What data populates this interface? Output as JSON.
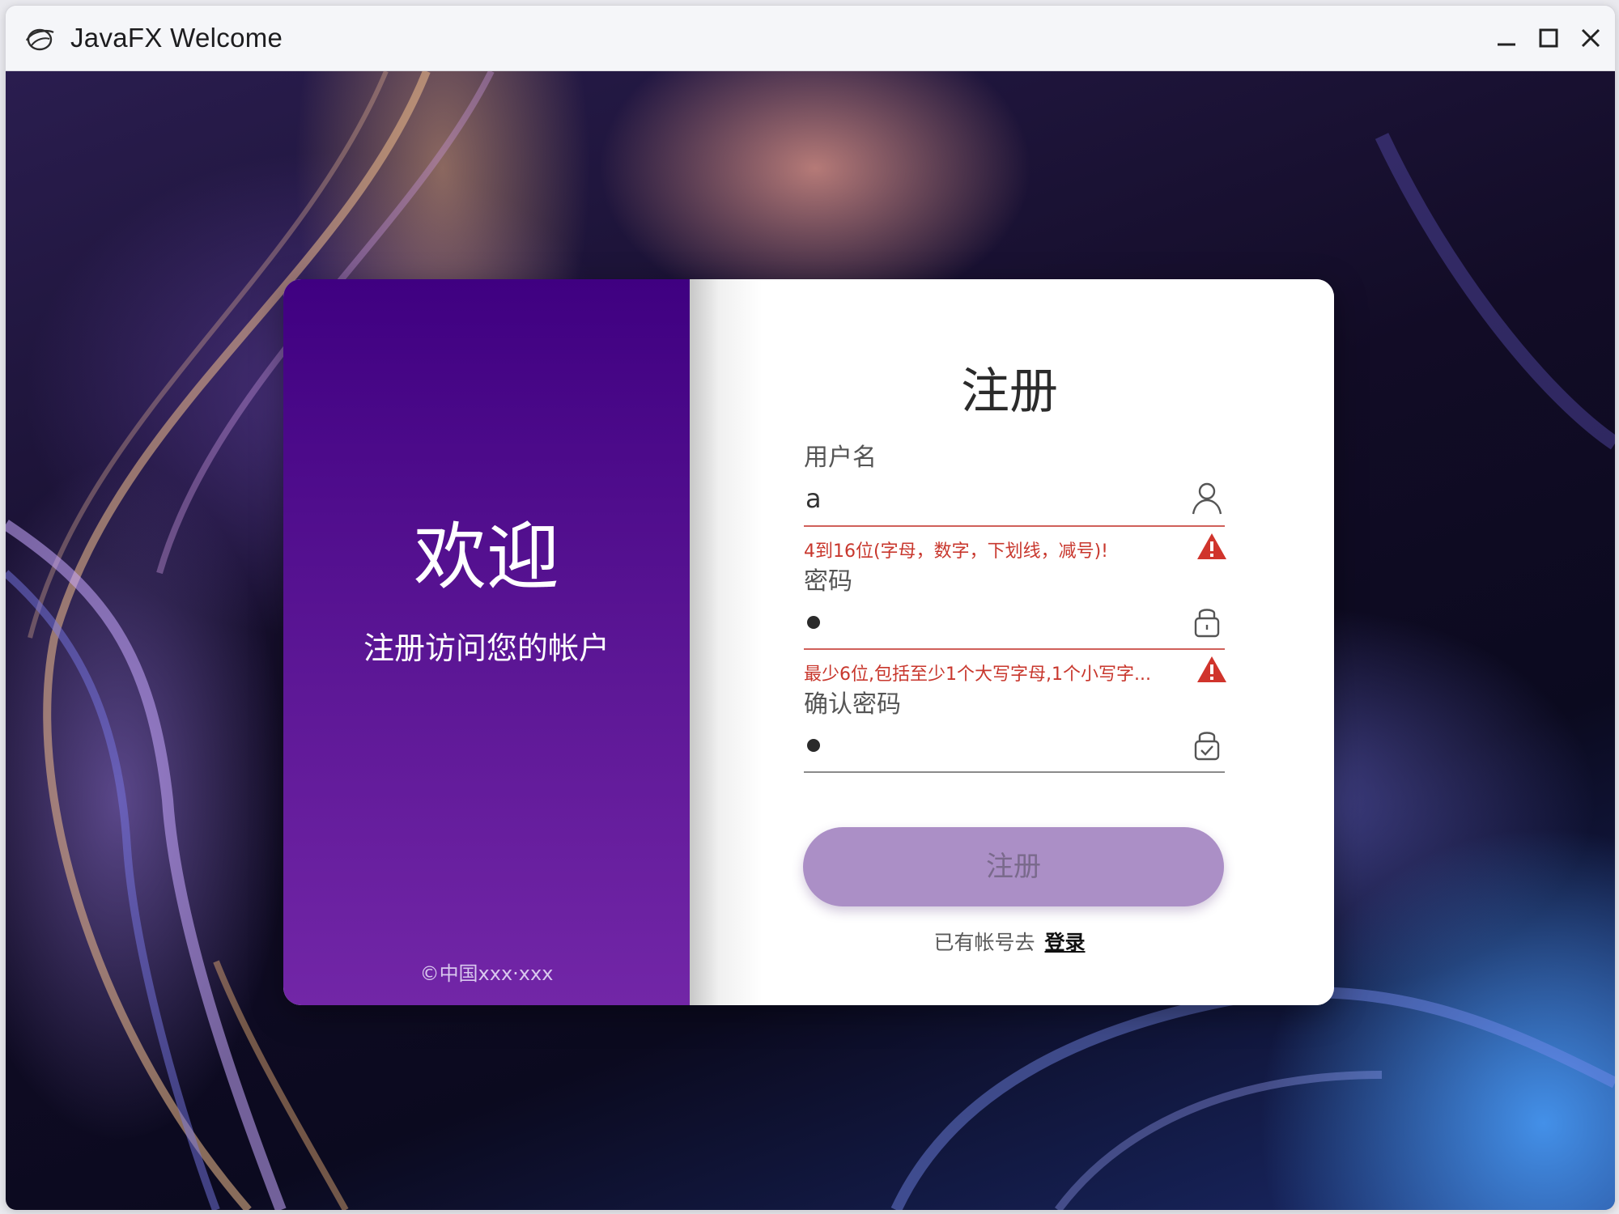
{
  "window": {
    "title": "JavaFX Welcome",
    "icons": [
      "app-logo-icon",
      "minimize-icon",
      "maximize-icon",
      "close-icon"
    ]
  },
  "left_panel": {
    "welcome": "欢迎",
    "subtitle": "注册访问您的帐户",
    "copyright": "©中国xxx·xxx",
    "gradient_top": "#3f0081",
    "gradient_bottom": "#7226a7"
  },
  "form": {
    "title": "注册",
    "username": {
      "label": "用户名",
      "value": "a",
      "icon": "user-icon",
      "error": "4到16位(字母，数字，下划线，减号)!"
    },
    "password": {
      "label": "密码",
      "masked_value": "●",
      "icon": "lock-icon",
      "error": "最少6位,包括至少1个大写字母,1个小写字..."
    },
    "confirm_password": {
      "label": "确认密码",
      "masked_value": "●",
      "icon": "lock-check-icon"
    },
    "submit_label": "注册",
    "footer_text": "已有帐号去",
    "login_link": "登录",
    "error_color": "#c8372d",
    "button_color": "#ab8fc6"
  }
}
